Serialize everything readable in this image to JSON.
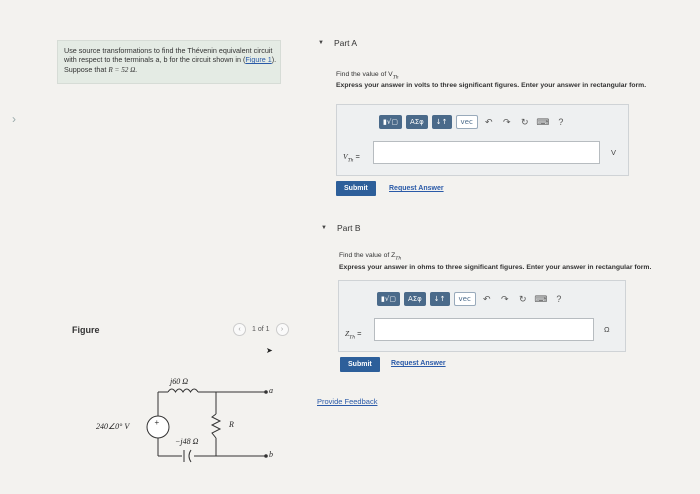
{
  "problem": {
    "text_1": "Use source transformations to find the Thévenin equivalent circuit with respect to the terminals a, b for the circuit shown in (",
    "figure_link": "Figure 1",
    "text_2": "). Suppose that ",
    "r_value": "R = 52 Ω."
  },
  "figure_panel": {
    "label": "Figure",
    "pager_text": "1 of 1",
    "prev_icon": "chevron-left-icon",
    "next_icon": "chevron-right-icon"
  },
  "circuit": {
    "source_label": "240∠0° V",
    "inductor_label": "j60 Ω",
    "capacitor_label": "−j48 Ω",
    "resistor_label": "R",
    "terminal_a": "a",
    "terminal_b": "b"
  },
  "part_a": {
    "title": "Part A",
    "prompt": "Find the value of V",
    "prompt_sub": "Th",
    "instruction": "Express your answer in volts to three significant figures. Enter your answer in rectangular form.",
    "answer_label": "V",
    "answer_label_sub": "Th",
    "answer_value": "",
    "unit": "V",
    "submit_label": "Submit",
    "request_label": "Request Answer"
  },
  "part_b": {
    "title": "Part B",
    "prompt": "Find the value of Z",
    "prompt_sub": "Th",
    "instruction": "Express your answer in ohms to three significant figures. Enter your answer in rectangular form.",
    "answer_label": "Z",
    "answer_label_sub": "Th",
    "answer_value": "",
    "unit": "Ω",
    "submit_label": "Submit",
    "request_label": "Request Answer"
  },
  "toolbar": {
    "template_btn": "▮√▢",
    "greek_btn": "ΑΣφ",
    "sort_btn": "↓↑",
    "vec_btn": "vec",
    "undo_icon": "undo-icon",
    "redo_icon": "redo-icon",
    "reset_icon": "reset-icon",
    "keyboard_icon": "keyboard-icon",
    "help_label": "?"
  },
  "footer": {
    "feedback_label": "Provide Feedback"
  },
  "colors": {
    "accent": "#2d5f9a",
    "link": "#2a5aa8",
    "problem_bg": "#e4ebe4"
  }
}
